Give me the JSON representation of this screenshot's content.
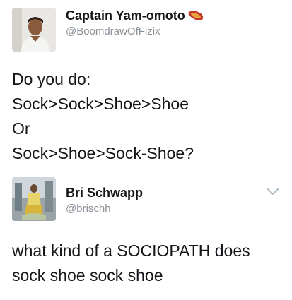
{
  "tweet1": {
    "display_name": "Captain Yam-omoto",
    "handle": "@BoomdrawOfFizix",
    "emoji_icon": "sweet-potato-icon",
    "lines": [
      "Do you do:",
      "Sock>Sock>Shoe>Shoe",
      "Or",
      "Sock>Shoe>Sock-Shoe?"
    ]
  },
  "tweet2": {
    "display_name": "Bri Schwapp",
    "handle": "@brischh",
    "lines": [
      "what kind of a SOCIOPATH does",
      "sock shoe sock shoe"
    ]
  },
  "colors": {
    "text": "#14171a",
    "muted": "#8a9199",
    "chevron": "#aab8c2"
  }
}
